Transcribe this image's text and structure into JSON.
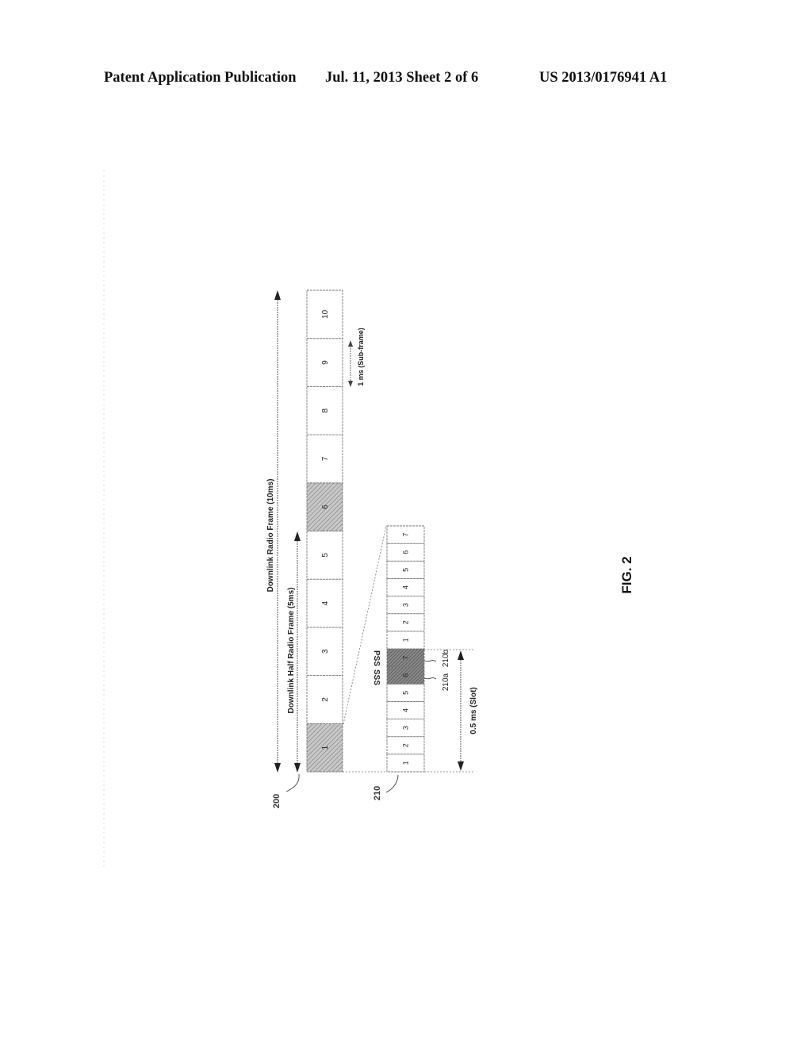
{
  "header": {
    "left": "Patent Application Publication",
    "middle": "Jul. 11, 2013   Sheet 2 of 6",
    "right": "US 2013/0176941 A1"
  },
  "figure": {
    "label": "FIG. 2",
    "radio_frame": {
      "ref": "200",
      "full_frame_label": "Downlink Radio Frame (10ms)",
      "half_frame_label": "Downlink Half Radio Frame (5ms)",
      "subframe_duration_label": "1 ms (Sub-frame)",
      "subframes": [
        {
          "label": "1",
          "shaded": true
        },
        {
          "label": "2",
          "shaded": false
        },
        {
          "label": "3",
          "shaded": false
        },
        {
          "label": "4",
          "shaded": false
        },
        {
          "label": "5",
          "shaded": false
        },
        {
          "label": "6",
          "shaded": true
        },
        {
          "label": "7",
          "shaded": false
        },
        {
          "label": "8",
          "shaded": false
        },
        {
          "label": "9",
          "shaded": false
        },
        {
          "label": "10",
          "shaded": false
        }
      ]
    },
    "subframe_detail": {
      "ref": "210",
      "slot_label": "0.5 ms (Slot)",
      "symbols": [
        {
          "label": "1",
          "shaded": false
        },
        {
          "label": "2",
          "shaded": false
        },
        {
          "label": "3",
          "shaded": false
        },
        {
          "label": "4",
          "shaded": false
        },
        {
          "label": "5",
          "shaded": false
        },
        {
          "label": "6",
          "shaded": true
        },
        {
          "label": "7",
          "shaded": true
        },
        {
          "label": "1",
          "shaded": false
        },
        {
          "label": "2",
          "shaded": false
        },
        {
          "label": "3",
          "shaded": false
        },
        {
          "label": "4",
          "shaded": false
        },
        {
          "label": "5",
          "shaded": false
        },
        {
          "label": "6",
          "shaded": false
        },
        {
          "label": "7",
          "shaded": false
        }
      ],
      "sss": {
        "label": "SSS",
        "ref": "210a"
      },
      "pss": {
        "label": "PSS",
        "ref": "210b"
      }
    }
  }
}
